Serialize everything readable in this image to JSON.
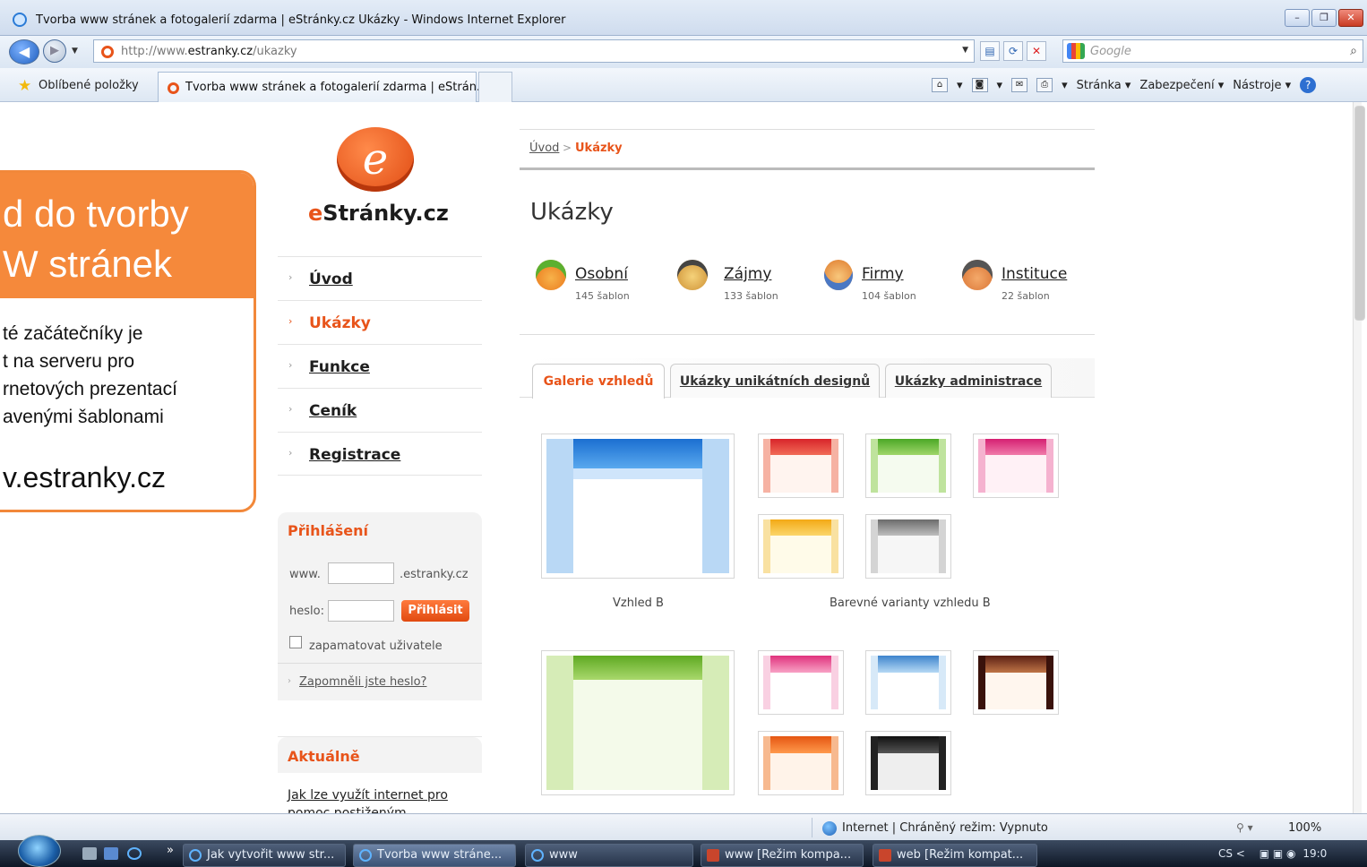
{
  "window": {
    "title": "Tvorba www stránek a fotogalerií zdarma | eStránky.cz Ukázky - Windows Internet Explorer",
    "buttons": [
      "–",
      "❐",
      "✕"
    ]
  },
  "address": {
    "url_prefix": "http://www.",
    "url_domain": "estranky.cz",
    "url_path": "/ukazky",
    "search_placeholder": "Google"
  },
  "favorites": {
    "label": "Oblíbené položky",
    "tab_title": "Tvorba www stránek a fotogalerií zdarma | eStrán..."
  },
  "commandbar": {
    "page": "Stránka ▾",
    "security": "Zabezpečení ▾",
    "tools": "Nástroje ▾"
  },
  "site": {
    "logo_letter": "e",
    "brand_prefix": "e",
    "brand_rest": "Stránky.cz",
    "nav": [
      "Úvod",
      "Ukázky",
      "Funkce",
      "Ceník",
      "Registrace"
    ],
    "active_nav": "Ukázky",
    "login": {
      "heading": "Přihlášení",
      "www_label": "www.",
      "domain_suffix": ".estranky.cz",
      "password_label": "heslo:",
      "submit": "Přihlásit",
      "remember": "zapamatovat uživatele",
      "forgot": "Zapomněli jste heslo?"
    },
    "news": {
      "heading": "Aktuálně",
      "link": "Jak lze využít internet pro pomoc postiženým"
    }
  },
  "main": {
    "breadcrumb": [
      "Úvod",
      "Ukázky"
    ],
    "breadcrumb_sep": ">",
    "title": "Ukázky",
    "categories": [
      {
        "name": "Osobní",
        "count": "145 šablon"
      },
      {
        "name": "Zájmy",
        "count": "133 šablon"
      },
      {
        "name": "Firmy",
        "count": "104 šablon"
      },
      {
        "name": "Instituce",
        "count": "22 šablon"
      }
    ],
    "tabs": [
      "Galerie vzhledů",
      "Ukázky unikátních designů",
      "Ukázky administrace"
    ],
    "captions": {
      "main": "Vzhled B",
      "variants": "Barevné varianty vzhledu B"
    }
  },
  "overlay": {
    "title_line1": "d do tvorby",
    "title_line2": "W stránek",
    "text_lines": [
      "té začátečníky je",
      "t na serveru pro",
      "rnetových prezentací",
      "avenými šablonami"
    ],
    "url": "v.estranky.cz"
  },
  "status": {
    "zone": "Internet | Chráněný režim: Vypnuto",
    "zoom": "100%"
  },
  "taskbar": {
    "buttons": [
      "Jak vytvořit www str...",
      "Tvorba www stráne...",
      "www",
      "www [Režim kompa...",
      "web [Režim kompat..."
    ],
    "tray": "CS  <",
    "time": "19:0"
  },
  "colors": {
    "accent": "#e8541a",
    "overlay": "#f5893b"
  }
}
